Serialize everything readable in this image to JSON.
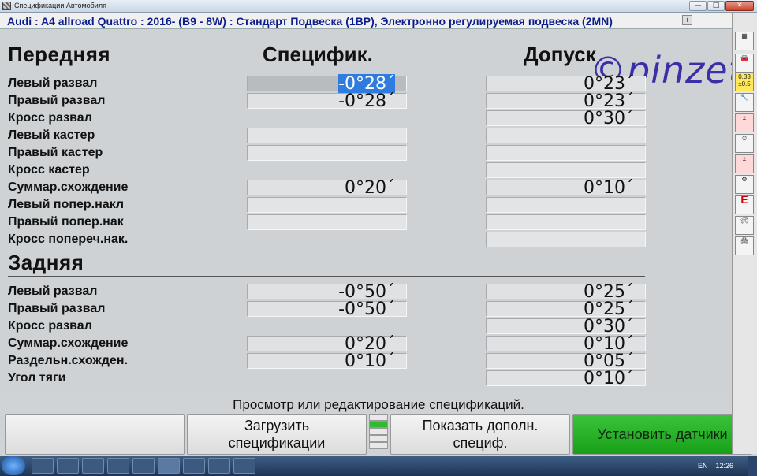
{
  "window": {
    "title": "Спецификации Автомобиля",
    "minimize": "—",
    "maximize": "□",
    "close": "✕"
  },
  "vehicle": {
    "text": "Audi : A4 allroad Quattro : 2016-   (B9 - 8W) : Стандарт Подвеска (1BP), Электронно регулируемая подвеска (2MN)"
  },
  "watermark": "©pinzet",
  "columns": {
    "spec": "Специфик.",
    "tolerance": "Допуск"
  },
  "front": {
    "title": "Передняя",
    "rows": [
      {
        "label": "Левый развал",
        "spec": "-0°28΄",
        "tol": "0°23΄"
      },
      {
        "label": "Правый развал",
        "spec": "-0°28΄",
        "tol": "0°23΄"
      },
      {
        "label": "Кросс развал",
        "spec": "",
        "tol": "0°30΄"
      },
      {
        "label": "Левый кастер",
        "spec": "",
        "tol": ""
      },
      {
        "label": "Правый кастер",
        "spec": "",
        "tol": ""
      },
      {
        "label": "Кросс кастер",
        "spec": "",
        "tol": ""
      },
      {
        "label": "Суммар.схождение",
        "spec": "0°20΄",
        "tol": "0°10΄"
      },
      {
        "label": "Левый попер.накл",
        "spec": "",
        "tol": ""
      },
      {
        "label": "Правый попер.нак",
        "spec": "",
        "tol": ""
      },
      {
        "label": "Кросс попереч.нак.",
        "spec": "",
        "tol": ""
      }
    ]
  },
  "rear": {
    "title": "Задняя",
    "rows": [
      {
        "label": "Левый развал",
        "spec": "-0°50΄",
        "tol": "0°25΄"
      },
      {
        "label": "Правый развал",
        "spec": "-0°50΄",
        "tol": "0°25΄"
      },
      {
        "label": "Кросс развал",
        "spec": "",
        "tol": "0°30΄"
      },
      {
        "label": "Суммар.схождение",
        "spec": "0°20΄",
        "tol": "0°10΄"
      },
      {
        "label": "Раздельн.схожден.",
        "spec": "0°10΄",
        "tol": "0°05΄"
      },
      {
        "label": "Угол тяги",
        "spec": "",
        "tol": "0°10΄"
      }
    ]
  },
  "status": "Просмотр или редактирование спецификаций.",
  "buttons": {
    "load_line1": "Загрузить",
    "load_line2": "спецификации",
    "show_line1": "Показать дополн.",
    "show_line2": "специф.",
    "install": "Установить датчики"
  },
  "toolbar": {
    "tool3_line1": "0.33",
    "tool3_line2": "±0.5"
  },
  "taskbar": {
    "lang": "EN",
    "clock": "12:26"
  }
}
